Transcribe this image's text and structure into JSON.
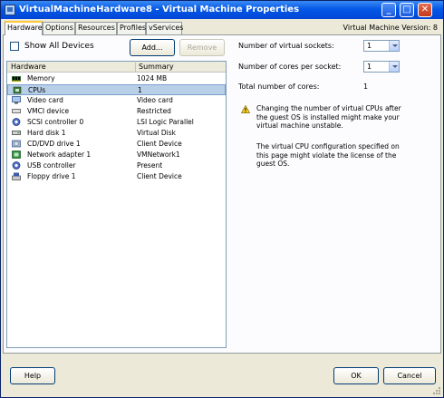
{
  "window": {
    "title": "VirtualMachineHardware8 - Virtual Machine Properties",
    "controls": [
      "_",
      "□",
      "✕"
    ]
  },
  "tabs": [
    {
      "label": "Hardware",
      "active": true
    },
    {
      "label": "Options",
      "active": false
    },
    {
      "label": "Resources",
      "active": false
    },
    {
      "label": "Profiles",
      "active": false
    },
    {
      "label": "vServices",
      "active": false
    }
  ],
  "version": "Virtual Machine Version: 8",
  "toolbar": {
    "show_all_devices": "Show All Devices",
    "show_all_checked": false,
    "add_label": "Add...",
    "remove_label": "Remove"
  },
  "hardware_table": {
    "columns": [
      "Hardware",
      "Summary"
    ],
    "rows": [
      {
        "name": "Memory",
        "summary": "1024 MB",
        "icon": "memory-icon",
        "selected": false
      },
      {
        "name": "CPUs",
        "summary": "1",
        "icon": "cpu-icon",
        "selected": true
      },
      {
        "name": "Video card",
        "summary": "Video card",
        "icon": "video-card-icon",
        "selected": false
      },
      {
        "name": "VMCI device",
        "summary": "Restricted",
        "icon": "vmci-device-icon",
        "selected": false
      },
      {
        "name": "SCSI controller 0",
        "summary": "LSI Logic Parallel",
        "icon": "scsi-controller-icon",
        "selected": false
      },
      {
        "name": "Hard disk 1",
        "summary": "Virtual Disk",
        "icon": "hard-disk-icon",
        "selected": false
      },
      {
        "name": "CD/DVD drive 1",
        "summary": "Client Device",
        "icon": "cd-dvd-icon",
        "selected": false
      },
      {
        "name": "Network adapter 1",
        "summary": "VMNetwork1",
        "icon": "network-adapter-icon",
        "selected": false
      },
      {
        "name": "USB controller",
        "summary": "Present",
        "icon": "usb-controller-icon",
        "selected": false
      },
      {
        "name": "Floppy drive 1",
        "summary": "Client Device",
        "icon": "floppy-drive-icon",
        "selected": false
      }
    ]
  },
  "cpu_settings": {
    "sockets_label": "Number of virtual sockets:",
    "sockets_value": "1",
    "cores_label": "Number of cores per socket:",
    "cores_value": "1",
    "total_label": "Total number of cores:",
    "total_value": "1",
    "warning_text": "Changing the number of virtual CPUs after the guest OS is installed might make your virtual machine unstable.",
    "license_text": "The virtual CPU configuration specified on this page might violate the license of the guest OS."
  },
  "footer": {
    "help_label": "Help",
    "ok_label": "OK",
    "cancel_label": "Cancel"
  },
  "colors": {
    "titlebar": "#0558e6",
    "selected_row": "#b8cfe8",
    "dialog_bg": "#ece9d8",
    "active_tab_accent": "#ffc83c"
  }
}
